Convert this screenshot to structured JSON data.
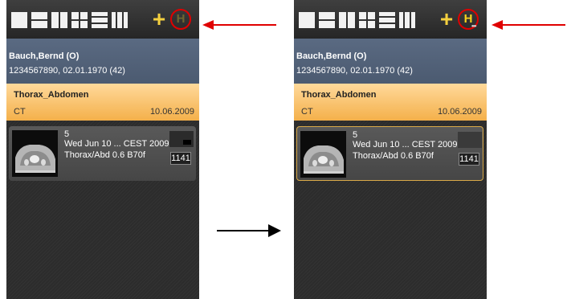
{
  "panels": [
    {
      "state": "before",
      "toolbar": {
        "h_label": "H",
        "h_active": false
      },
      "patient": {
        "name": "Bauch,Bernd (O)",
        "info": "1234567890, 02.01.1970 (42)"
      },
      "study": {
        "title": "Thorax_Abdomen",
        "modality": "CT",
        "date": "10.06.2009"
      },
      "series": {
        "number": "5",
        "datetime": "Wed Jun 10 ... CEST 2009",
        "description": "Thorax/Abd  0.6  B70f",
        "count": "1141",
        "selected": false
      }
    },
    {
      "state": "after",
      "toolbar": {
        "h_label": "H",
        "h_active": true
      },
      "patient": {
        "name": "Bauch,Bernd (O)",
        "info": "1234567890, 02.01.1970 (42)"
      },
      "study": {
        "title": "Thorax_Abdomen",
        "modality": "CT",
        "date": "10.06.2009"
      },
      "series": {
        "number": "5",
        "datetime": "Wed Jun 10 ... CEST 2009",
        "description": "Thorax/Abd  0.6  B70f",
        "count": "1141",
        "selected": true
      }
    }
  ],
  "colors": {
    "accent_yellow": "#f7d21e",
    "highlight_circle": "#e00000",
    "study_header": "#f4b04a",
    "patient_header": "#52627a",
    "selected_border": "#d9a948"
  },
  "icons": [
    "layout-1x1-icon",
    "layout-1x2-icon",
    "layout-2x1-icon",
    "layout-2x2-icon",
    "layout-1x3-icon",
    "layout-3x1-icon",
    "plus-icon",
    "h-icon"
  ]
}
